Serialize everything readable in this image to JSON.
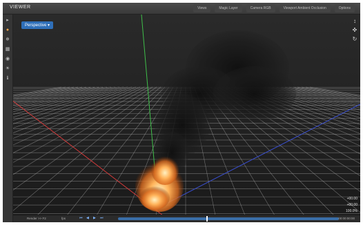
{
  "window": {
    "title": "VIEWER"
  },
  "menu": [
    {
      "label": "Views"
    },
    {
      "label": "Magic Layer"
    },
    {
      "label": "Camera RGB"
    },
    {
      "label": "Viewport Ambient Occlusion"
    },
    {
      "label": "Options"
    }
  ],
  "viewport": {
    "camera_label": "Perspective"
  },
  "readouts": {
    "line1": "+00.00",
    "line2": "+00.00",
    "line3": "100.0%"
  },
  "timeline": {
    "frame_label": "Render >> F2",
    "fps_label": "fps",
    "time_label": "00:00:00:00",
    "progress": 0.4
  },
  "icons": {
    "left": [
      "select-icon",
      "move-icon",
      "emitter-icon",
      "grid-icon",
      "camera-icon",
      "light-icon",
      "info-icon"
    ],
    "right": [
      "zoom-icon",
      "pan-icon",
      "orbit-icon"
    ]
  },
  "colors": {
    "accent": "#2f6fb9",
    "axis_x": "#d23a3a",
    "axis_y": "#3fbf4a",
    "axis_z": "#3a4fd2",
    "fire": "#f29a3a"
  }
}
